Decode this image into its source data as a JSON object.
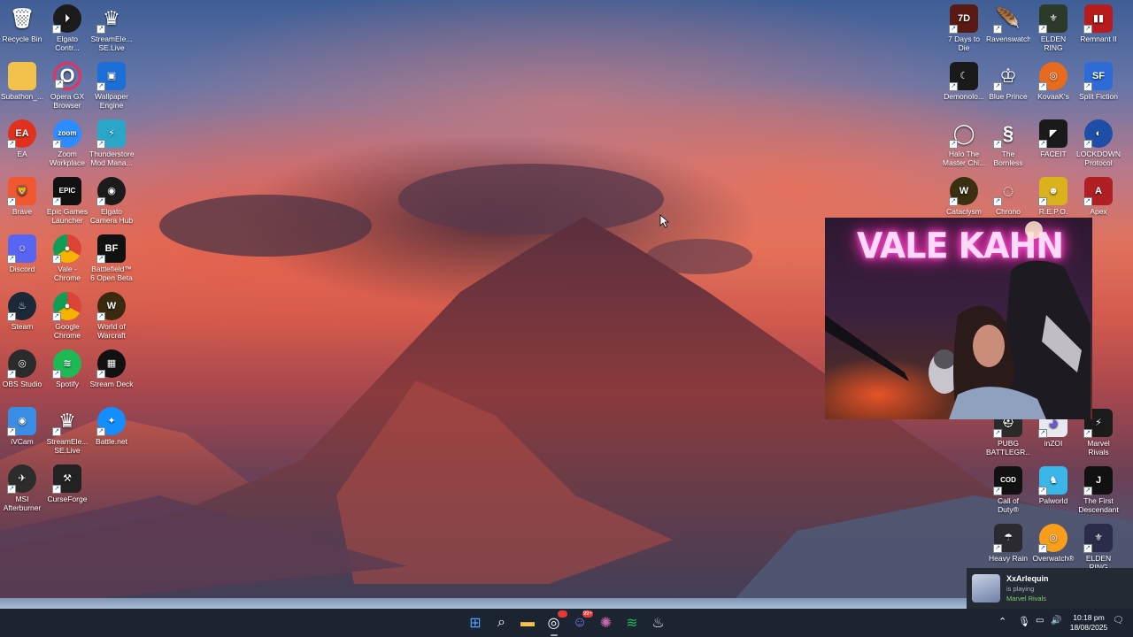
{
  "desktop_icons_left": [
    {
      "label": "Recycle Bin",
      "icon": "recycle-bin-icon",
      "bg": "transparent",
      "glyph": "🗑",
      "shortcut": false
    },
    {
      "label": "Elgato Contr...",
      "icon": "elgato-control-center-icon",
      "bg": "#1b1b1b",
      "glyph": "⏵",
      "round": true
    },
    {
      "label": "StreamEle... SE.Live",
      "icon": "streamelements-icon",
      "bg": "transparent",
      "glyph": "♛"
    },
    {
      "label": "Subathon_...",
      "icon": "folder-icon",
      "bg": "#f3c24b",
      "glyph": "",
      "shortcut": false
    },
    {
      "label": "Opera GX Browser",
      "icon": "opera-gx-icon",
      "bg": "transparent",
      "glyph": "O",
      "round": true,
      "border": "#e8305e"
    },
    {
      "label": "Wallpaper Engine",
      "icon": "wallpaper-engine-icon",
      "bg": "#1d6fd8",
      "glyph": "▣"
    },
    {
      "label": "EA",
      "icon": "ea-icon",
      "bg": "#e2301f",
      "glyph": "EA",
      "round": true
    },
    {
      "label": "Zoom Workplace",
      "icon": "zoom-icon",
      "bg": "#2d8cff",
      "glyph": "zoom",
      "round": true
    },
    {
      "label": "Thunderstore Mod Mana...",
      "icon": "thunderstore-icon",
      "bg": "#2aa6c9",
      "glyph": "⚡"
    },
    {
      "label": "Brave",
      "icon": "brave-icon",
      "bg": "#f1582f",
      "glyph": "🦁"
    },
    {
      "label": "Epic Games Launcher",
      "icon": "epic-games-icon",
      "bg": "#111",
      "glyph": "EPIC"
    },
    {
      "label": "Elgato Camera Hub",
      "icon": "elgato-camera-hub-icon",
      "bg": "#1b1b1b",
      "glyph": "◉",
      "round": true
    },
    {
      "label": "Discord",
      "icon": "discord-icon",
      "bg": "#5865f2",
      "glyph": "☺"
    },
    {
      "label": "Vale - Chrome",
      "icon": "chrome-profile-icon",
      "bg": "conic-gradient(#db4437 0 33%, #f4b400 0 66%, #0f9d58 0)",
      "glyph": "●",
      "round": true
    },
    {
      "label": "Battlefield™ 6 Open Beta",
      "icon": "battlefield-icon",
      "bg": "#111",
      "glyph": "BF"
    },
    {
      "label": "Steam",
      "icon": "steam-icon",
      "bg": "#1b2838",
      "glyph": "♨",
      "round": true
    },
    {
      "label": "Google Chrome",
      "icon": "chrome-icon",
      "bg": "conic-gradient(#db4437 0 33%, #f4b400 0 66%, #0f9d58 0)",
      "glyph": "●",
      "round": true
    },
    {
      "label": "World of Warcraft",
      "icon": "world-of-warcraft-icon",
      "bg": "#3a2a10",
      "glyph": "W",
      "round": true
    },
    {
      "label": "OBS Studio",
      "icon": "obs-icon",
      "bg": "#2b2b2b",
      "glyph": "◎",
      "round": true
    },
    {
      "label": "Spotify",
      "icon": "spotify-icon",
      "bg": "#1db954",
      "glyph": "≋",
      "round": true
    },
    {
      "label": "Stream Deck",
      "icon": "stream-deck-icon",
      "bg": "#111",
      "glyph": "▦",
      "round": true
    },
    {
      "label": "iVCam",
      "icon": "ivcam-icon",
      "bg": "#3a8ee6",
      "glyph": "◉"
    },
    {
      "label": "StreamEle... SE.Live",
      "icon": "streamelements-icon",
      "bg": "transparent",
      "glyph": "♛"
    },
    {
      "label": "Battle.net",
      "icon": "battle-net-icon",
      "bg": "#148eff",
      "glyph": "✦",
      "round": true
    },
    {
      "label": "MSI Afterburner",
      "icon": "msi-afterburner-icon",
      "bg": "#2c2c2c",
      "glyph": "✈",
      "round": true
    },
    {
      "label": "CurseForge",
      "icon": "curseforge-icon",
      "bg": "#222",
      "glyph": "⚒"
    }
  ],
  "desktop_icons_right": [
    {
      "label": "7 Days to Die",
      "icon": "7-days-to-die-icon",
      "bg": "#5a1a14",
      "glyph": "7D"
    },
    {
      "label": "Ravenswatch",
      "icon": "ravenswatch-icon",
      "bg": "transparent",
      "glyph": "🪶"
    },
    {
      "label": "ELDEN RING",
      "icon": "elden-ring-icon",
      "bg": "#2c3a2a",
      "glyph": "⚜"
    },
    {
      "label": "Remnant II",
      "icon": "remnant-ii-icon",
      "bg": "#b81c1c",
      "glyph": "▮▮"
    },
    {
      "label": "Demonolo...",
      "icon": "demonologist-icon",
      "bg": "#1a1a1a",
      "glyph": "☾"
    },
    {
      "label": "Blue Prince",
      "icon": "blue-prince-icon",
      "bg": "transparent",
      "glyph": "♔"
    },
    {
      "label": "KovaaK's",
      "icon": "kovaaks-icon",
      "bg": "#e86a1e",
      "glyph": "◎",
      "round": true
    },
    {
      "label": "Split Fiction",
      "icon": "split-fiction-icon",
      "bg": "#2d6bd6",
      "glyph": "SF"
    },
    {
      "label": "Halo The Master Chi...",
      "icon": "halo-mcc-icon",
      "bg": "transparent",
      "glyph": "◯"
    },
    {
      "label": "The Bornless Demo",
      "icon": "bornless-icon",
      "bg": "transparent",
      "glyph": "§"
    },
    {
      "label": "FACEIT",
      "icon": "faceit-icon",
      "bg": "#1a1a1a",
      "glyph": "◤"
    },
    {
      "label": "LOCKDOWN Protocol",
      "icon": "lockdown-protocol-icon",
      "bg": "#1f4ea8",
      "glyph": "◐",
      "round": true
    },
    {
      "label": "Cataclysm",
      "icon": "cataclysm-icon",
      "bg": "#3a2f10",
      "glyph": "W",
      "round": true
    },
    {
      "label": "Chrono",
      "icon": "chrono-icon",
      "bg": "transparent",
      "glyph": "◌"
    },
    {
      "label": "R.E.P.O.",
      "icon": "repo-icon",
      "bg": "#d9b21d",
      "glyph": "☻"
    },
    {
      "label": "Apex",
      "icon": "apex-icon",
      "bg": "#b01f24",
      "glyph": "A"
    },
    {
      "label": "PUBG BATTLEGR...",
      "icon": "pubg-icon",
      "bg": "#2a2a2a",
      "glyph": "⛑"
    },
    {
      "label": "inZOI",
      "icon": "inzoi-icon",
      "bg": "#e8e8f0",
      "glyph": "◕"
    },
    {
      "label": "Marvel Rivals",
      "icon": "marvel-rivals-icon",
      "bg": "#1b1b1b",
      "glyph": "⚡"
    },
    {
      "label": "Call of Duty®",
      "icon": "call-of-duty-icon",
      "bg": "#111",
      "glyph": "COD"
    },
    {
      "label": "Palworld",
      "icon": "palworld-icon",
      "bg": "#3bb6e8",
      "glyph": "♞"
    },
    {
      "label": "The First Descendant",
      "icon": "the-first-descendant-icon",
      "bg": "#111",
      "glyph": "J"
    },
    {
      "label": "Heavy Rain",
      "icon": "heavy-rain-icon",
      "bg": "#2a2a30",
      "glyph": "☂"
    },
    {
      "label": "Overwatch®",
      "icon": "overwatch-icon",
      "bg": "#f99e1a",
      "glyph": "◎",
      "round": true
    },
    {
      "label": "ELDEN RING NIGHTREIGN",
      "icon": "elden-ring-nightreign-icon",
      "bg": "#2a2c4a",
      "glyph": "⚜"
    }
  ],
  "webcam": {
    "neon_sign": "VALE KAHN"
  },
  "notification": {
    "username": "XxArlequin",
    "status": "is playing",
    "game": "Marvel Rivals"
  },
  "taskbar": {
    "apps": [
      {
        "name": "start-button",
        "glyph": "⊞",
        "color": "#4aa3ff"
      },
      {
        "name": "search-button",
        "glyph": "⌕",
        "color": "#ffffff"
      },
      {
        "name": "file-explorer-button",
        "glyph": "▬",
        "color": "#f3c24b"
      },
      {
        "name": "obs-taskbar-button",
        "glyph": "◎",
        "color": "#ffffff",
        "badge": "",
        "active": true
      },
      {
        "name": "discord-taskbar-button",
        "glyph": "☺",
        "color": "#7b84ff",
        "badge": "99+"
      },
      {
        "name": "streamelements-taskbar-button",
        "glyph": "✺",
        "color": "#c86aa8"
      },
      {
        "name": "spotify-taskbar-button",
        "glyph": "≋",
        "color": "#1db954"
      },
      {
        "name": "steam-taskbar-button",
        "glyph": "♨",
        "color": "#d9e3ee"
      }
    ],
    "time": "10:18 pm",
    "date": "18/08/2025"
  }
}
